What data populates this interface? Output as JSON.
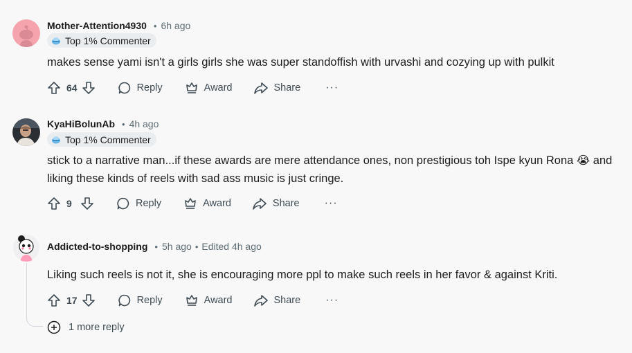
{
  "comments": [
    {
      "username": "Mother-Attention4930",
      "time": "6h ago",
      "flair": "Top 1% Commenter",
      "text": "makes sense yami isn't a girls girls she was super standoffish with urvashi and cozying up with pulkit",
      "votes": "64",
      "avatar": "reddit-snoo-pink"
    },
    {
      "username": "KyaHiBolunAb",
      "time": "4h ago",
      "flair": "Top 1% Commenter",
      "text": "stick to a narrative man...if these awards are mere attendance ones, non prestigious toh Ispe kyun Rona 😭 and liking these kinds of reels with sad ass music is just cringe.",
      "votes": "9",
      "avatar": "photo-man"
    },
    {
      "username": "Addicted-to-shopping",
      "time": "5h ago",
      "edited": "Edited 4h ago",
      "text": "Liking such reels is not it, she is encouraging more ppl to make such reels in her favor & against Kriti.",
      "votes": "17",
      "avatar": "cartoon-girl"
    }
  ],
  "actions": {
    "reply": "Reply",
    "award": "Award",
    "share": "Share",
    "more": "···"
  },
  "more_replies": "1 more reply",
  "colors": {
    "background": "#f8f8f9",
    "text": "#1c1c1c",
    "muted": "#5c6c74",
    "flair_bg": "#eaedef"
  }
}
